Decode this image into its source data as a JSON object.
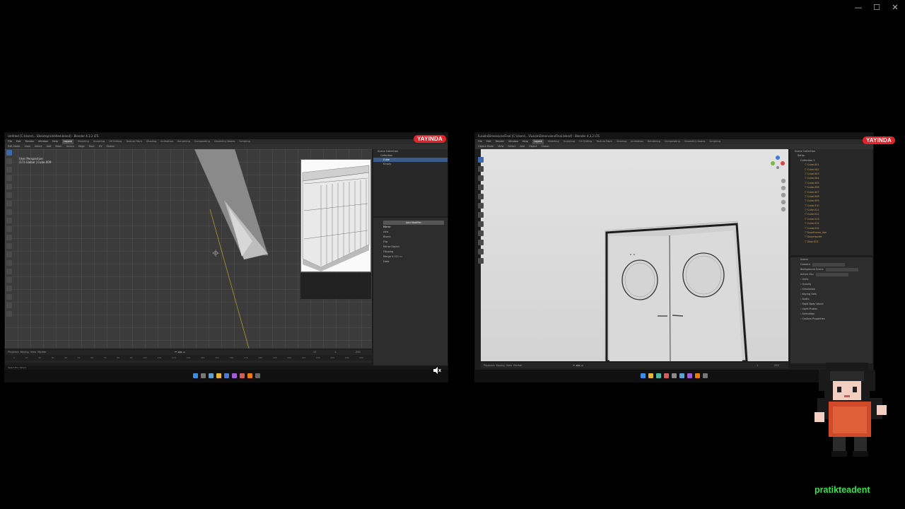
{
  "overlay": {
    "live_badge": "YAYINDA",
    "channel_name": "pratikteadent",
    "window_controls": [
      "—",
      "☐",
      "✕"
    ]
  },
  "left_screen": {
    "title": "Untitled [C:\\Users\\...\\Desktop\\Untitled.blend] - Blender 4.3.2 LTS",
    "menus": [
      "File",
      "Edit",
      "Render",
      "Window",
      "Help"
    ],
    "workspaces": [
      "Layout",
      "Modeling",
      "Sculpting",
      "UV Editing",
      "Texture Paint",
      "Shading",
      "Animation",
      "Rendering",
      "Compositing",
      "Geometry Nodes",
      "Scripting"
    ],
    "active_workspace": "Layout",
    "header": [
      "Edit Mode",
      "View",
      "Select",
      "Add",
      "Mesh",
      "Vertex",
      "Edge",
      "Face",
      "UV",
      "Global"
    ],
    "viewport_info": [
      "User Perspective",
      "(17) Global | Cube.009"
    ],
    "outliner": [
      "Scene Collection",
      "Collection",
      "Cube",
      "Empty"
    ],
    "selected_object": "Cube",
    "modifier": {
      "add_label": "Add Modifier",
      "name": "Mirror",
      "rows": [
        "Axis",
        "Bisect",
        "Flip",
        "Mirror Object",
        "Clipping",
        "Merge",
        "Data"
      ],
      "merge_value": "0.001 m"
    },
    "timeline": [
      "Playback",
      "Keying",
      "View",
      "Marker"
    ],
    "ruler_ticks": [
      "0",
      "10",
      "20",
      "30",
      "40",
      "50",
      "60",
      "70",
      "80",
      "90",
      "100",
      "110",
      "120",
      "130",
      "140",
      "150",
      "160",
      "170",
      "180",
      "190",
      "200",
      "210",
      "220",
      "230",
      "240",
      "250"
    ],
    "frame_current": "17",
    "frame_start": "1",
    "frame_end": "250",
    "status": "Select    Box Select"
  },
  "right_screen": {
    "title": "FusioInDimensionsFinal [C:\\Users\\...\\FusioInDimensionsFinal.blend] - Blender 4.3.2 LTS",
    "menus": [
      "File",
      "Edit",
      "Render",
      "Window",
      "Help"
    ],
    "workspaces": [
      "Layout",
      "Modeling",
      "Sculpting",
      "UV Editing",
      "Texture Paint",
      "Shading",
      "Animation",
      "Rendering",
      "Compositing",
      "Geometry Nodes",
      "Scripting"
    ],
    "active_workspace": "Layout",
    "header": [
      "Object Mode",
      "View",
      "Select",
      "Add",
      "Object",
      "Global"
    ],
    "outliner_top": [
      "Scene Collection",
      "Sahip",
      "Collection 2"
    ],
    "outliner_items": [
      "Cube.001",
      "Cube.002",
      "Cube.003",
      "Cube.004",
      "Cube.005",
      "Cube.006",
      "Cube.007",
      "Cube.008",
      "Cube.009",
      "Cube.010",
      "Cube.011",
      "Cube.012",
      "Cube.013",
      "Cube.014",
      "Cube.015",
      "DoorFrame_low",
      "DoorHandle",
      "Door.001"
    ],
    "scene_props": [
      "Scene",
      "Camera",
      "Background Scene",
      "Active Clip",
      "Units",
      "Gravity",
      "Simulation",
      "Keying Sets",
      "Audio",
      "Rigid Body World",
      "Light Probes",
      "Animation",
      "Custom Properties"
    ],
    "timeline": [
      "Playback",
      "Keying",
      "View",
      "Marker"
    ],
    "frame_start": "1",
    "frame_end": "250"
  }
}
